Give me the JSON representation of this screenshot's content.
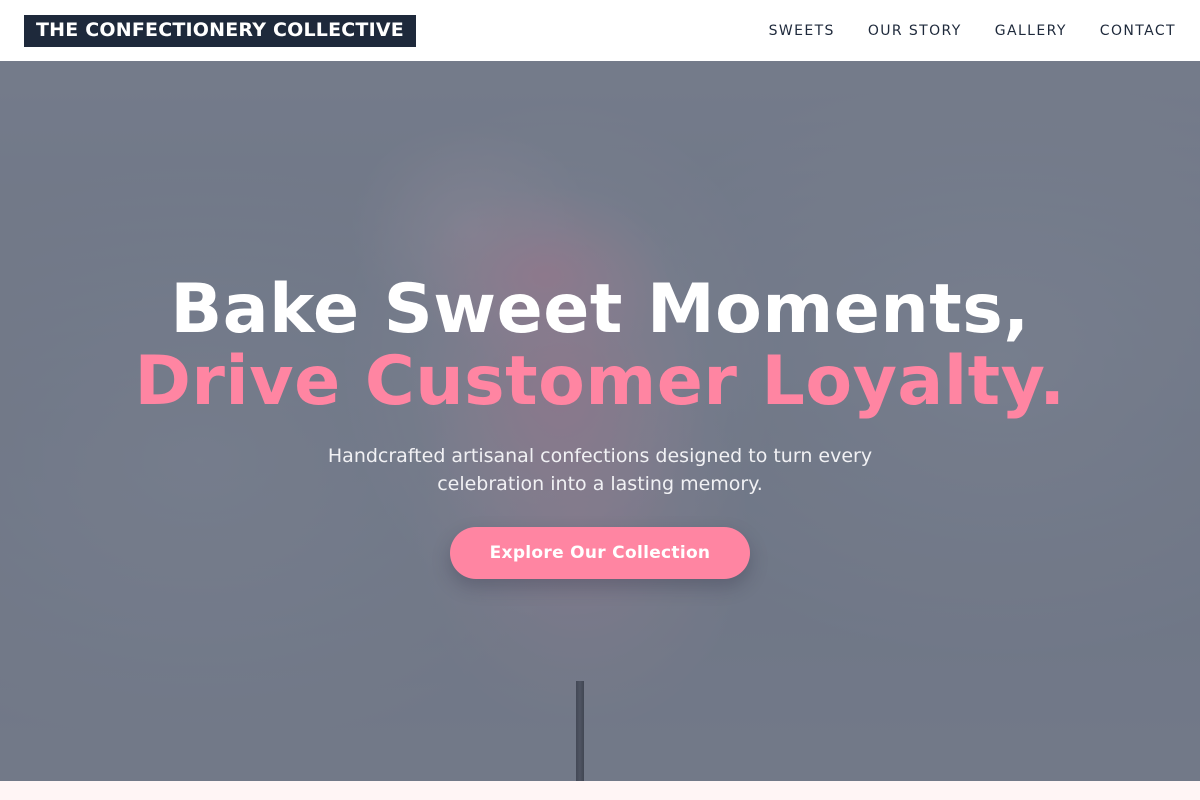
{
  "header": {
    "logo_text": "THE CONFECTIONERY COLLECTIVE",
    "nav": [
      {
        "label": "SWEETS"
      },
      {
        "label": "OUR STORY"
      },
      {
        "label": "GALLERY"
      },
      {
        "label": "CONTACT"
      }
    ]
  },
  "hero": {
    "headline_line1": "Bake Sweet Moments,",
    "headline_line2": "Drive Customer Loyalty.",
    "subtext": "Handcrafted artisanal confections designed to turn every celebration into a lasting memory.",
    "cta_label": "Explore Our Collection"
  },
  "colors": {
    "brand_dark": "#1e293b",
    "accent_pink": "#ff85a2",
    "section_background": "#fff5f5"
  }
}
